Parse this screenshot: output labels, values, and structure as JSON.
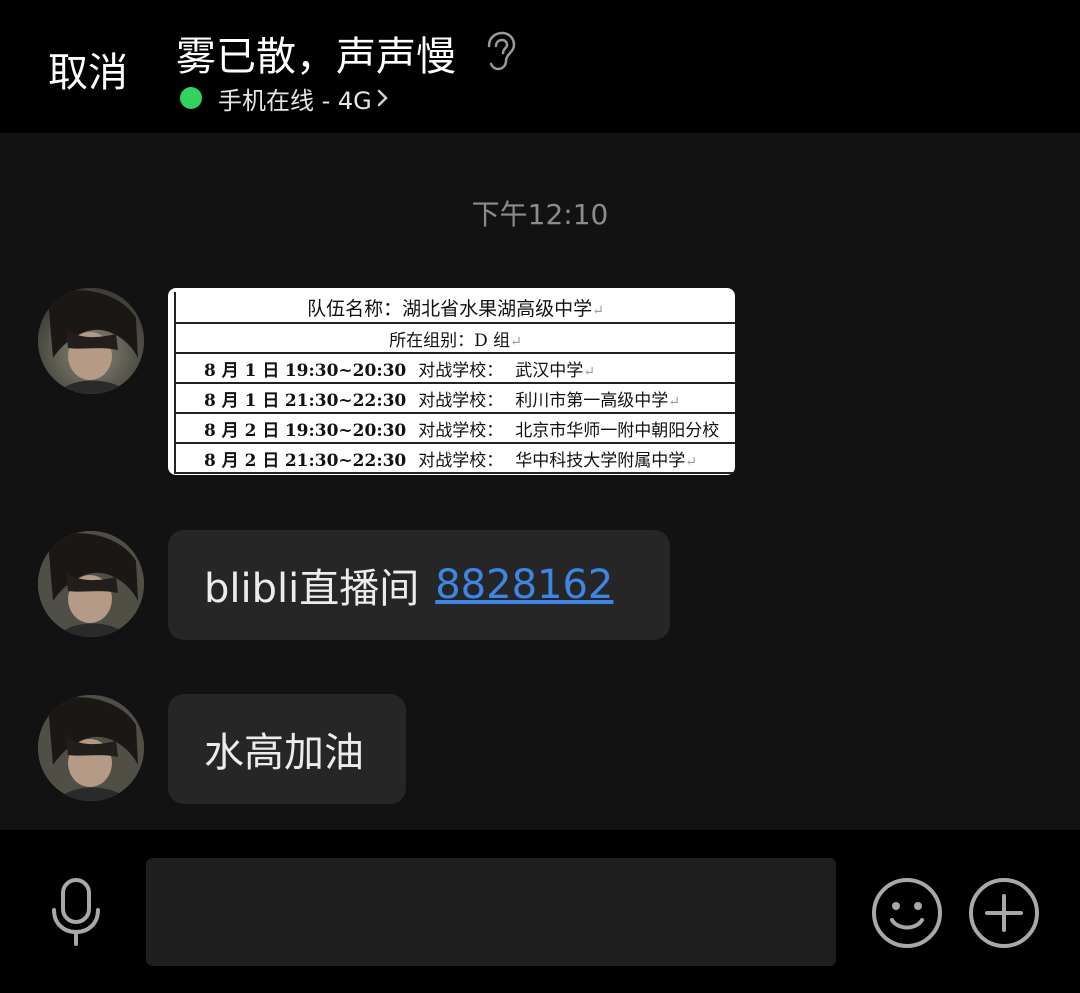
{
  "header": {
    "cancel_label": "取消",
    "contact_name": "雾已散，声声慢",
    "status_text": "手机在线 - 4G",
    "status_color": "#2fd35d",
    "icons": [
      "ear-icon",
      "chevron-right-icon"
    ]
  },
  "chat": {
    "timestamp": "下午12:10",
    "image_message": {
      "title": "队伍名称：湖北省水果湖高级中学",
      "group": "所在组别：D 组",
      "label": "对战学校：",
      "matches": [
        {
          "date": "8 月 1 日",
          "time": "19:30~20:30",
          "school": "武汉中学"
        },
        {
          "date": "8 月 1 日",
          "time": "21:30~22:30",
          "school": "利川市第一高级中学"
        },
        {
          "date": "8 月 2 日",
          "time": "19:30~20:30",
          "school": "北京市华师一附中朝阳分校"
        },
        {
          "date": "8 月 2 日",
          "time": "21:30~22:30",
          "school": "华中科技大学附属中学"
        }
      ]
    },
    "text_messages": [
      {
        "text": "blibli直播间",
        "link": "8828162"
      },
      {
        "text": "水高加油"
      }
    ],
    "link_color": "#3d86e6"
  },
  "composer": {
    "icons": [
      "microphone-icon",
      "emoji-icon",
      "plus-icon"
    ]
  }
}
